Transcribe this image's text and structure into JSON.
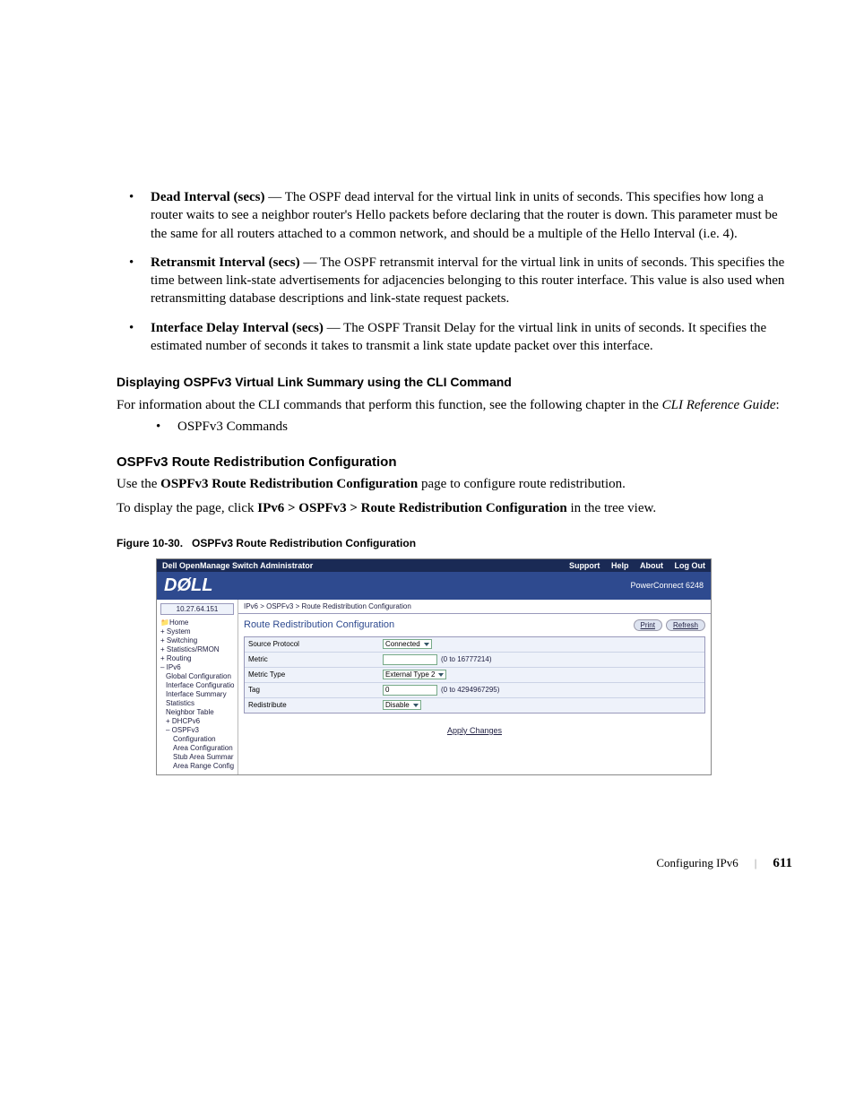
{
  "bullets": [
    {
      "term": "Dead Interval (secs)",
      "desc": " — The OSPF dead interval for the virtual link in units of seconds. This specifies how long a router waits to see a neighbor router's Hello packets before declaring that the router is down. This parameter must be the same for all routers attached to a common network, and should be a multiple of the Hello Interval (i.e. 4)."
    },
    {
      "term": "Retransmit Interval (secs)",
      "desc": " — The OSPF retransmit interval for the virtual link in units of seconds. This specifies the time between link-state advertisements for adjacencies belonging to this router interface. This value is also used when retransmitting database descriptions and link-state request packets."
    },
    {
      "term": "Interface Delay Interval (secs)",
      "desc": " — The OSPF Transit Delay for the virtual link in units of seconds. It specifies the estimated number of seconds it takes to transmit a link state update packet over this interface."
    }
  ],
  "sub1": "Displaying OSPFv3 Virtual Link Summary using the CLI Command",
  "p1a": "For information about the CLI commands that perform this function, see the following chapter in the ",
  "p1b": "CLI Reference Guide",
  "p1c": ":",
  "inner1": "OSPFv3 Commands",
  "heading2": "OSPFv3 Route Redistribution Configuration",
  "p2_pre": "Use the ",
  "p2_bold": "OSPFv3 Route Redistribution Configuration",
  "p2_post": " page to configure route redistribution.",
  "p3_pre": "To display the page, click ",
  "p3_bold": "IPv6 > OSPFv3 > Route Redistribution Configuration",
  "p3_post": " in the tree view.",
  "figcap_a": "Figure 10-30.",
  "figcap_b": "OSPFv3 Route Redistribution Configuration",
  "ss": {
    "title": "Dell OpenManage Switch Administrator",
    "nav": {
      "support": "Support",
      "help": "Help",
      "about": "About",
      "logout": "Log Out"
    },
    "logo": "DØLL",
    "model": "PowerConnect 6248",
    "ip": "10.27.64.151",
    "tree": {
      "home": "Home",
      "system": "System",
      "switching": "Switching",
      "statsrmon": "Statistics/RMON",
      "routing": "Routing",
      "ipv6": "IPv6",
      "globalcfg": "Global Configuration",
      "ifacecfg": "Interface Configuratio",
      "ifacesum": "Interface Summary",
      "statistics": "Statistics",
      "neighbor": "Neighbor Table",
      "dhcpv6": "DHCPv6",
      "ospfv3": "OSPFv3",
      "cfg": "Configuration",
      "areacfg": "Area Configuration",
      "stubsum": "Stub Area Summar",
      "arearange": "Area Range Config"
    },
    "crumb": "IPv6 > OSPFv3 > Route Redistribution Configuration",
    "pagetitle": "Route Redistribution Configuration",
    "btn_print": "Print",
    "btn_refresh": "Refresh",
    "rows": {
      "r1_label": "Source Protocol",
      "r1_val": "Connected",
      "r2_label": "Metric",
      "r2_val": "",
      "r2_hint": "(0 to 16777214)",
      "r3_label": "Metric Type",
      "r3_val": "External Type 2",
      "r4_label": "Tag",
      "r4_val": "0",
      "r4_hint": "(0 to 4294967295)",
      "r5_label": "Redistribute",
      "r5_val": "Disable"
    },
    "apply": "Apply Changes"
  },
  "footer": {
    "section": "Configuring IPv6",
    "page": "611"
  }
}
